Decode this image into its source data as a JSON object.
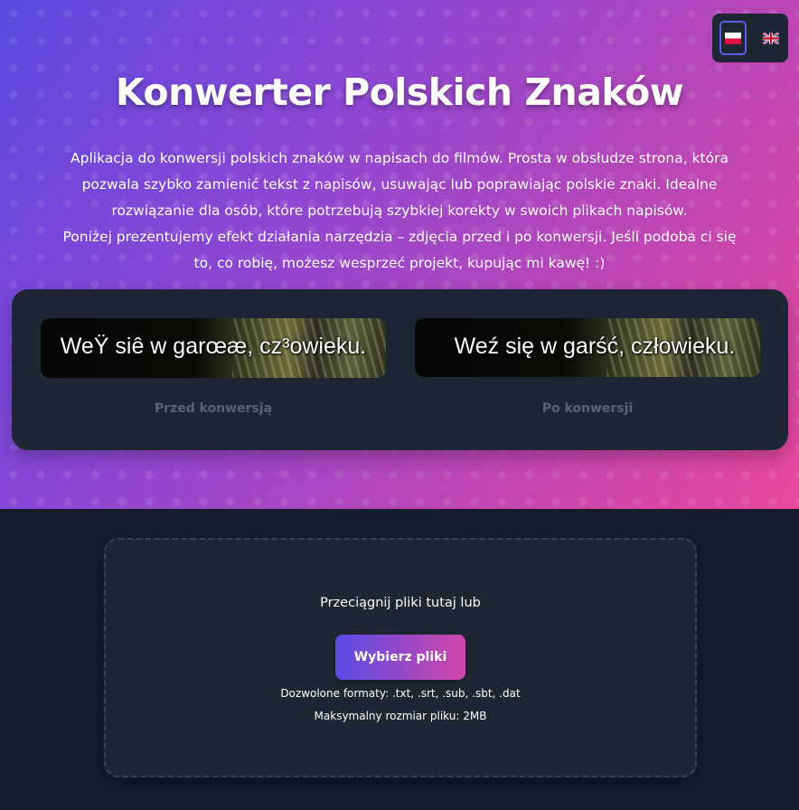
{
  "header": {
    "title": "Konwerter Polskich Znaków",
    "description_lines": [
      "Aplikacja do konwersji polskich znaków w napisach do filmów. Prosta w obsłudze strona, która",
      "pozwala szybko zamienić tekst z napisów, usuwając lub poprawiając polskie znaki. Idealne",
      "rozwiązanie dla osób, które potrzebują szybkiej korekty w swoich plikach napisów.",
      "Poniżej prezentujemy efekt działania narzędzia – zdjęcia przed i po konwersji. Jeśli podoba ci się",
      "to, co robię, możesz wesprzeć projekt, kupując mi kawę! :)"
    ]
  },
  "language_switcher": {
    "options": [
      {
        "icon": "polish-flag-icon",
        "active": true
      },
      {
        "icon": "uk-flag-icon",
        "active": false
      }
    ]
  },
  "comparison": {
    "before": {
      "subtitle_text": "WeŸ siê w garœæ, cz³owieku.",
      "caption": "Przed konwersją"
    },
    "after": {
      "subtitle_text": "Weź się w garść, człowieku.",
      "caption": "Po konwersji"
    }
  },
  "upload": {
    "drop_text": "Przeciągnij pliki tutaj lub",
    "button_label": "Wybierz pliki",
    "formats_text": "Dozwolone formaty: .txt, .srt, .sub, .sbt, .dat",
    "max_size_text": "Maksymalny rozmiar pliku: 2MB"
  },
  "colors": {
    "hero_gradient_start": "#5b4ae0",
    "hero_gradient_end": "#e9489a",
    "card_background": "#1f2633",
    "page_background": "#151b2b",
    "active_language_border": "#5b5ee8"
  }
}
